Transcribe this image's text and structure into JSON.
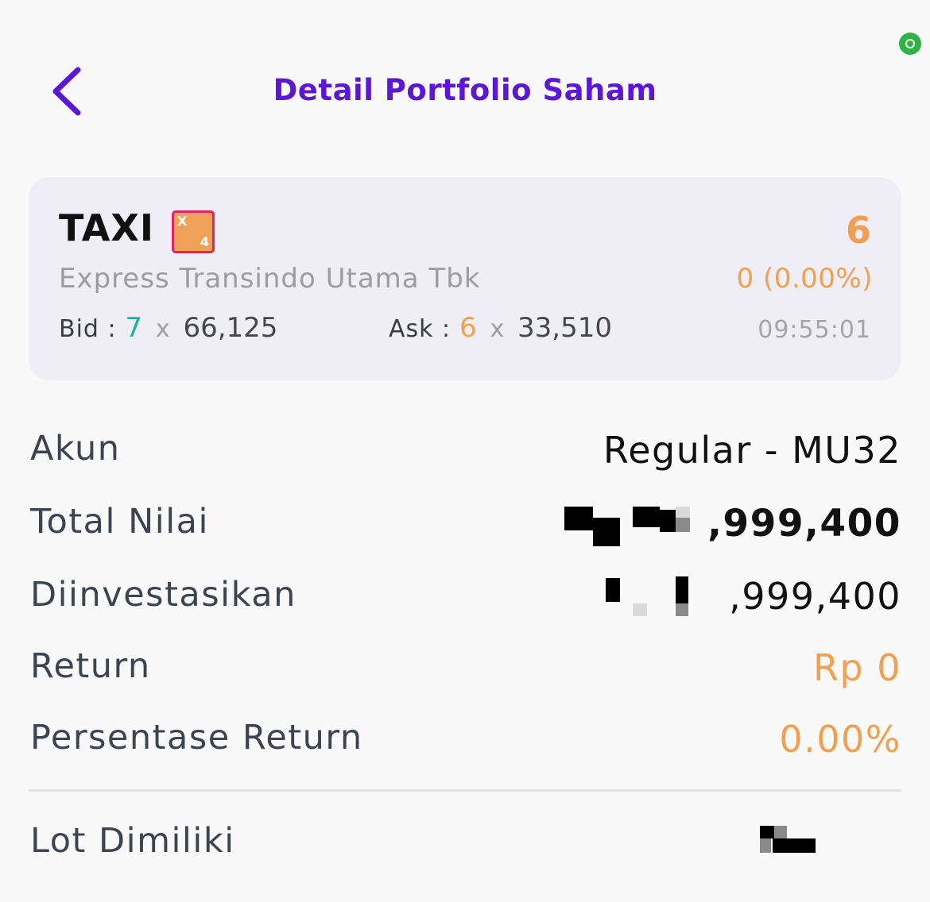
{
  "header": {
    "title": "Detail Portfolio Saham"
  },
  "stock": {
    "ticker": "TAXI",
    "notation_badge": {
      "letter": "X",
      "number": "4"
    },
    "company_name": "Express Transindo Utama Tbk",
    "last_price": "6",
    "change": "0 (0.00%)",
    "bid_label": "Bid :",
    "bid_lot": "7",
    "bid_volume": "66,125",
    "ask_label": "Ask :",
    "ask_lot": "6",
    "ask_volume": "33,510",
    "times_sign": "x",
    "time": "09:55:01"
  },
  "details": {
    "account_label": "Akun",
    "account_value": "Regular - MU32",
    "total_value_label": "Total Nilai",
    "total_value_visible": ",999,400",
    "invested_label": "Diinvestasikan",
    "invested_visible": ",999,400",
    "return_label": "Return",
    "return_value": "Rp 0",
    "return_pct_label": "Persentase Return",
    "return_pct_value": "0.00%",
    "lot_label": "Lot Dimiliki"
  },
  "colors": {
    "accent": "#5c17d6",
    "positive": "#1db596",
    "neutral_change": "#f0a050",
    "status_dot": "#2fb344"
  }
}
